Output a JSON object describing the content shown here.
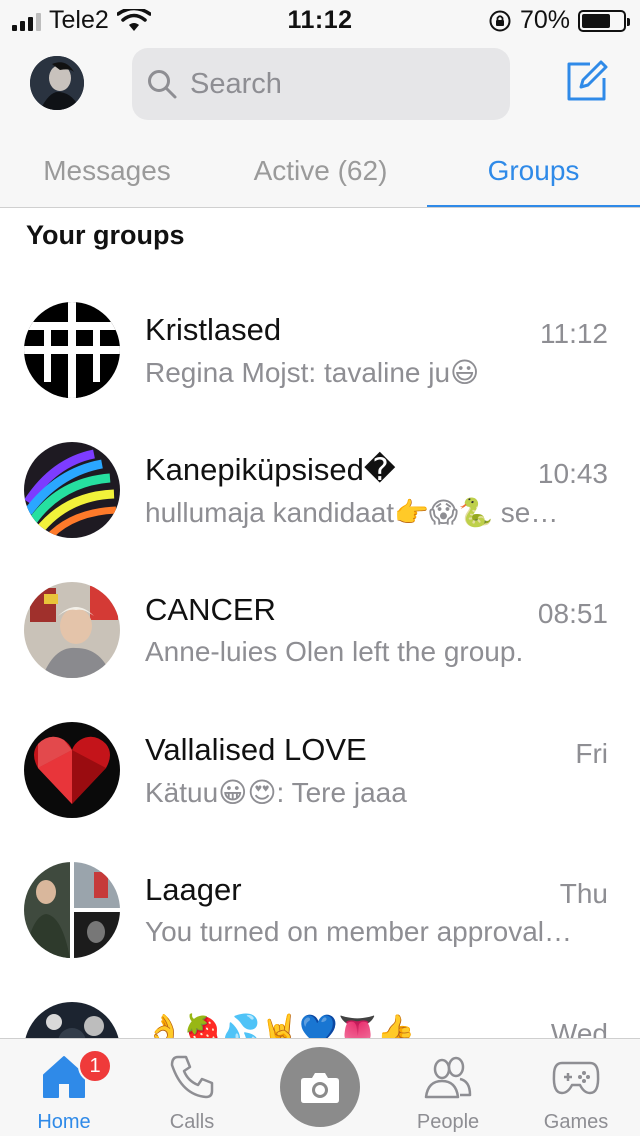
{
  "status_bar": {
    "carrier": "Tele2",
    "time": "11:12",
    "battery_percent": "70%",
    "battery_level": 0.7
  },
  "header": {
    "search_placeholder": "Search",
    "tabs": [
      {
        "label": "Messages",
        "active": false
      },
      {
        "label": "Active (62)",
        "active": false
      },
      {
        "label": "Groups",
        "active": true
      }
    ],
    "accent_color": "#2f8ae8"
  },
  "section_title": "Your groups",
  "groups": [
    {
      "name": "Kristlased",
      "time": "11:12",
      "preview": "Regina Mojst: tavaline ju😃"
    },
    {
      "name": "Kanepiküpsised�",
      "time": "10:43",
      "preview": "hullumaja kandidaat👉😱🐍 se…"
    },
    {
      "name": "CANCER",
      "time": "08:51",
      "preview": "Anne-luies Olen left the group."
    },
    {
      "name": "Vallalised LOVE",
      "time": "Fri",
      "preview": "Kätuu😀😍: Tere jaaa"
    },
    {
      "name": "Laager",
      "time": "Thu",
      "preview": "You turned on member approval…"
    },
    {
      "name": "👌🍓💦🤘💙👅👍",
      "time": "Wed",
      "preview": ""
    }
  ],
  "tab_bar": {
    "home_label": "Home",
    "home_badge": "1",
    "calls_label": "Calls",
    "people_label": "People",
    "games_label": "Games",
    "camera_icon": "camera-icon"
  }
}
